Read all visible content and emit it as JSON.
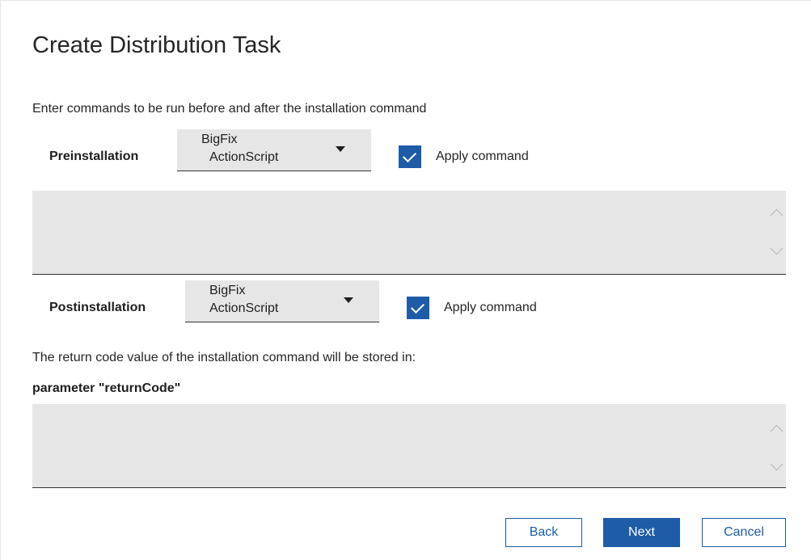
{
  "dialog": {
    "title": "Create Distribution Task",
    "instructions": "Enter commands to be run before and after the installation command"
  },
  "preinstallation": {
    "label": "Preinstallation",
    "dropdown_line1": "BigFix",
    "dropdown_line2": "ActionScript",
    "apply_checked": true,
    "apply_label": "Apply command",
    "command_value": ""
  },
  "postinstallation": {
    "label": "Postinstallation",
    "dropdown_line1": "BigFix",
    "dropdown_line2": "ActionScript",
    "apply_checked": true,
    "apply_label": "Apply command",
    "command_value": ""
  },
  "return_code": {
    "description": "The return code value of the installation command will be stored in:",
    "parameter": "parameter \"returnCode\"",
    "value": ""
  },
  "buttons": {
    "back": "Back",
    "next": "Next",
    "cancel": "Cancel"
  },
  "icons": {
    "dropdown_arrow": "caret-down-icon",
    "checkbox": "checkmark-icon",
    "scroll_up": "chevron-up-icon",
    "scroll_down": "chevron-down-icon"
  },
  "colors": {
    "accent": "#1e5ca8",
    "field_background": "#e6e6e6"
  }
}
